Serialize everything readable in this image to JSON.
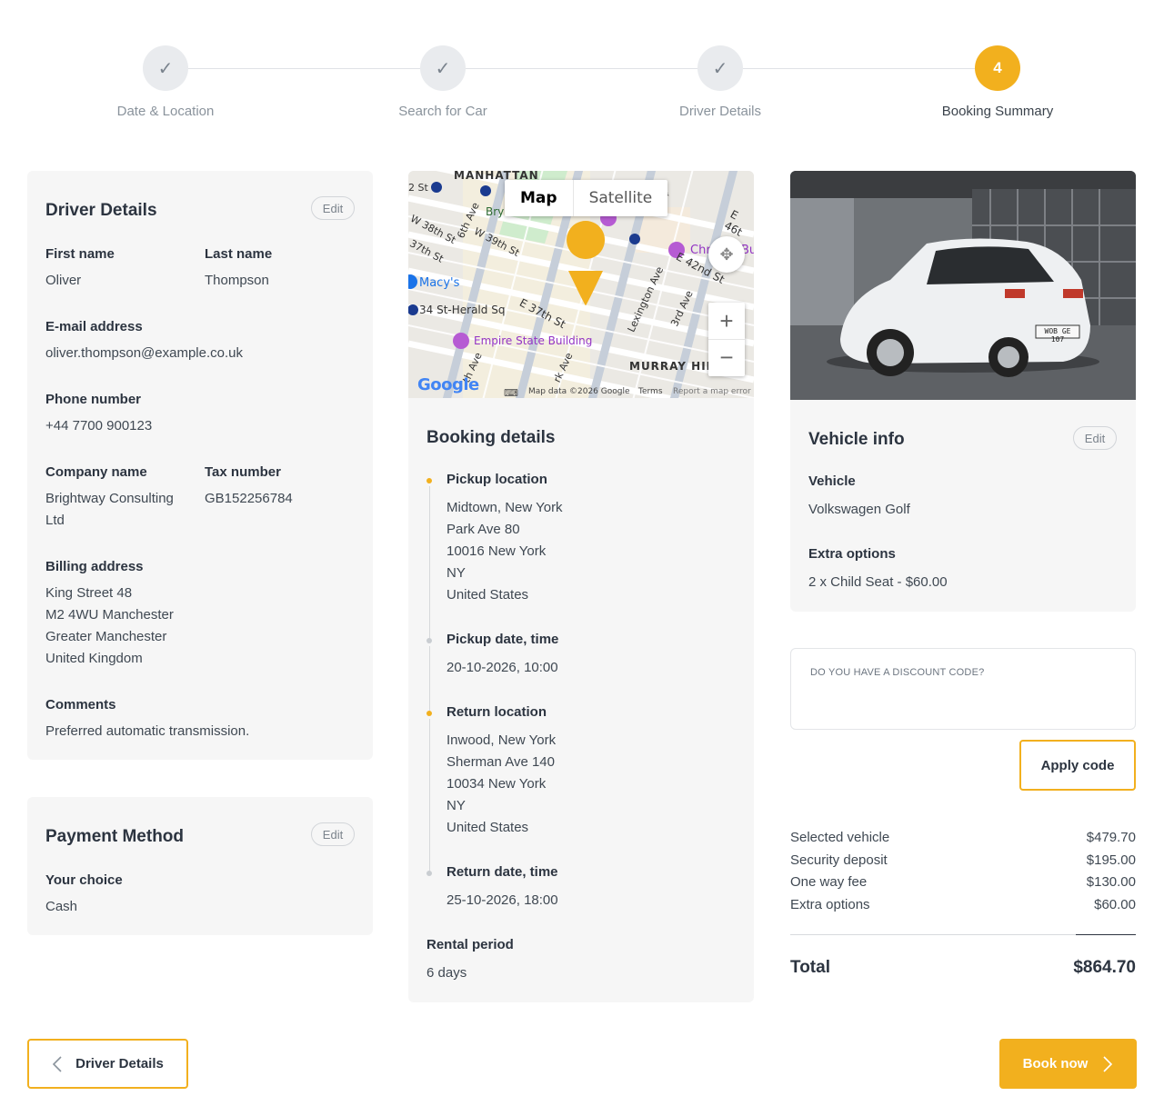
{
  "colors": {
    "accent": "#f2b01e",
    "card_bg": "#f6f6f6",
    "text": "#2c3440",
    "muted": "#8a939c"
  },
  "stepper": {
    "steps": [
      {
        "label": "Date & Location",
        "state": "done",
        "icon": "check-icon"
      },
      {
        "label": "Search for Car",
        "state": "done",
        "icon": "check-icon"
      },
      {
        "label": "Driver Details",
        "state": "done",
        "icon": "check-icon"
      },
      {
        "label": "Booking Summary",
        "state": "active",
        "number": "4"
      }
    ]
  },
  "driver": {
    "title": "Driver Details",
    "edit": "Edit",
    "first_name_label": "First name",
    "first_name": "Oliver",
    "last_name_label": "Last name",
    "last_name": "Thompson",
    "email_label": "E-mail address",
    "email": "oliver.thompson@example.co.uk",
    "phone_label": "Phone number",
    "phone": "+44 7700 900123",
    "company_label": "Company name",
    "company_line1": "Brightway Consulting",
    "company_line2": "Ltd",
    "tax_label": "Tax number",
    "tax": "GB152256784",
    "billing_label": "Billing address",
    "billing": [
      "King Street 48",
      "M2 4WU Manchester",
      "Greater Manchester",
      "United Kingdom"
    ],
    "comments_label": "Comments",
    "comments": "Preferred automatic transmission."
  },
  "payment": {
    "title": "Payment Method",
    "edit": "Edit",
    "choice_label": "Your choice",
    "choice": "Cash"
  },
  "map": {
    "tab_map": "Map",
    "tab_satellite": "Satellite",
    "zoom_in": "+",
    "zoom_out": "−",
    "google": "Google",
    "footer_data": "Map data ©2026 Google",
    "footer_terms": "Terms",
    "footer_report": "Report a map error",
    "labels": {
      "manhattan": "MANHATTAN",
      "st2": "2 St",
      "bryant": "Bry",
      "w38": "W 38th St",
      "w39": "W 39th St",
      "ave6": "6th Ave",
      "st37": "37th St",
      "macys": "Macy's",
      "herald": "34 St-Herald Sq",
      "e37": "E 37th St",
      "esb": "Empire State Building",
      "lexington": "Lexington Ave",
      "ave3": "3rd Ave",
      "e42": "E 42nd St",
      "e46": "E 46t",
      "chr": "Chr",
      "bu": "Bu",
      "murray": "MURRAY HIL",
      "park": "rk Ave",
      "fifth": "th Ave",
      "st_right": "St"
    }
  },
  "booking": {
    "title": "Booking details",
    "pickup_location_label": "Pickup location",
    "pickup_location": [
      "Midtown, New York",
      "Park Ave 80",
      "10016 New York",
      "NY",
      "United States"
    ],
    "pickup_date_label": "Pickup date, time",
    "pickup_date": "20-10-2026, 10:00",
    "return_location_label": "Return location",
    "return_location": [
      "Inwood, New York",
      "Sherman Ave 140",
      "10034 New York",
      "NY",
      "United States"
    ],
    "return_date_label": "Return date, time",
    "return_date": "25-10-2026, 18:00",
    "rental_period_label": "Rental period",
    "rental_period": "6 days"
  },
  "vehicle": {
    "title": "Vehicle info",
    "edit": "Edit",
    "vehicle_label": "Vehicle",
    "vehicle": "Volkswagen Golf",
    "extras_label": "Extra options",
    "extras": "2 x Child Seat - $60.00",
    "plate": "WOB GE 107"
  },
  "discount": {
    "placeholder": "DO YOU HAVE A DISCOUNT CODE?",
    "apply": "Apply code"
  },
  "prices": [
    {
      "label": "Selected vehicle",
      "value": "$479.70"
    },
    {
      "label": "Security deposit",
      "value": "$195.00"
    },
    {
      "label": "One way fee",
      "value": "$130.00"
    },
    {
      "label": "Extra options",
      "value": "$60.00"
    }
  ],
  "total": {
    "label": "Total",
    "value": "$864.70"
  },
  "nav": {
    "back": "Driver Details",
    "book": "Book now"
  }
}
